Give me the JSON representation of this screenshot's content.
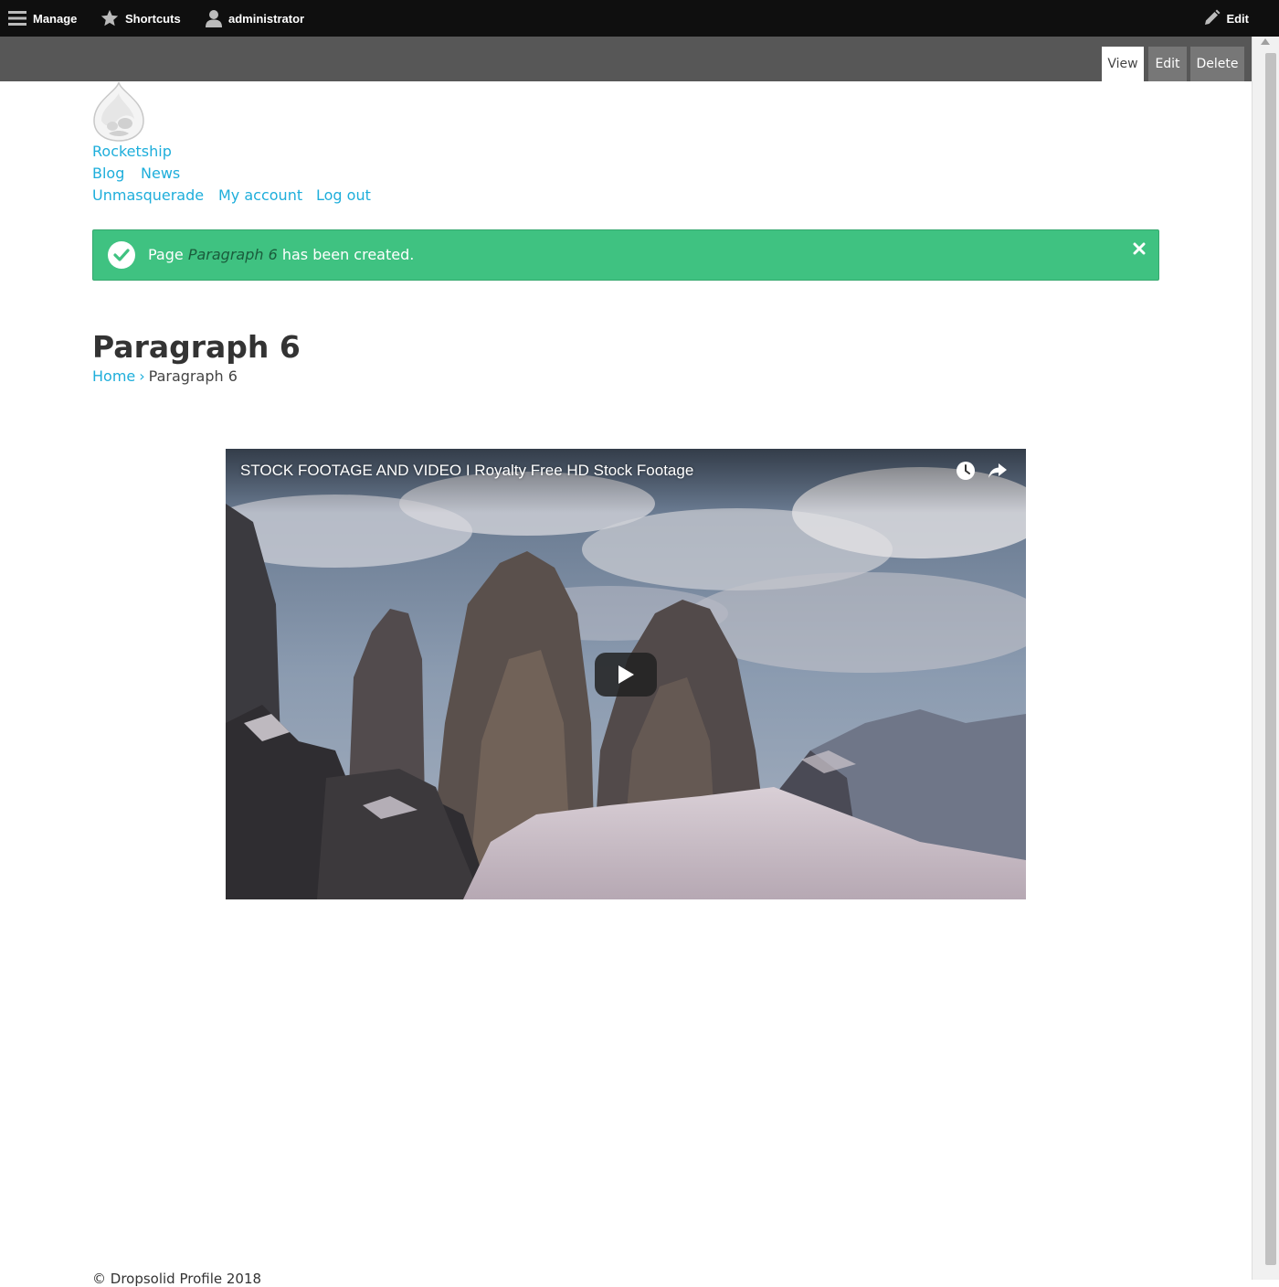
{
  "toolbar": {
    "manage": {
      "label": "Manage",
      "icon": "hamburger-icon"
    },
    "shortcuts": {
      "label": "Shortcuts",
      "icon": "star-icon"
    },
    "user": {
      "label": "administrator",
      "icon": "person-icon"
    },
    "edit": {
      "label": "Edit",
      "icon": "pencil-icon"
    }
  },
  "tasks": {
    "view": "View",
    "edit": "Edit",
    "delete": "Delete",
    "active": "View"
  },
  "header": {
    "logo_icon": "drupal-drop-icon",
    "site_name": "Rocketship",
    "main_nav": [
      "Blog",
      "News"
    ],
    "account_nav": [
      "Unmasquerade",
      "My account",
      "Log out"
    ]
  },
  "status": {
    "prefix": "Page ",
    "title": "Paragraph 6",
    "suffix": " has been created.",
    "icon": "checkmark-icon",
    "close_icon": "close-icon"
  },
  "page": {
    "title": "Paragraph 6",
    "breadcrumb": {
      "home": "Home",
      "separator": "›",
      "current": "Paragraph 6"
    }
  },
  "video": {
    "title": "STOCK FOOTAGE AND VIDEO I Royalty Free HD Stock Footage",
    "icons": [
      "clock-icon",
      "share-icon",
      "play-icon"
    ]
  },
  "footer": {
    "text": "© Dropsolid Profile 2018"
  },
  "colors": {
    "toolbar": "#0f0f0f",
    "tasks_bar": "#575757",
    "link": "#1eaedb",
    "status_bg": "#3fc281",
    "status_em": "#1a5c3c"
  }
}
